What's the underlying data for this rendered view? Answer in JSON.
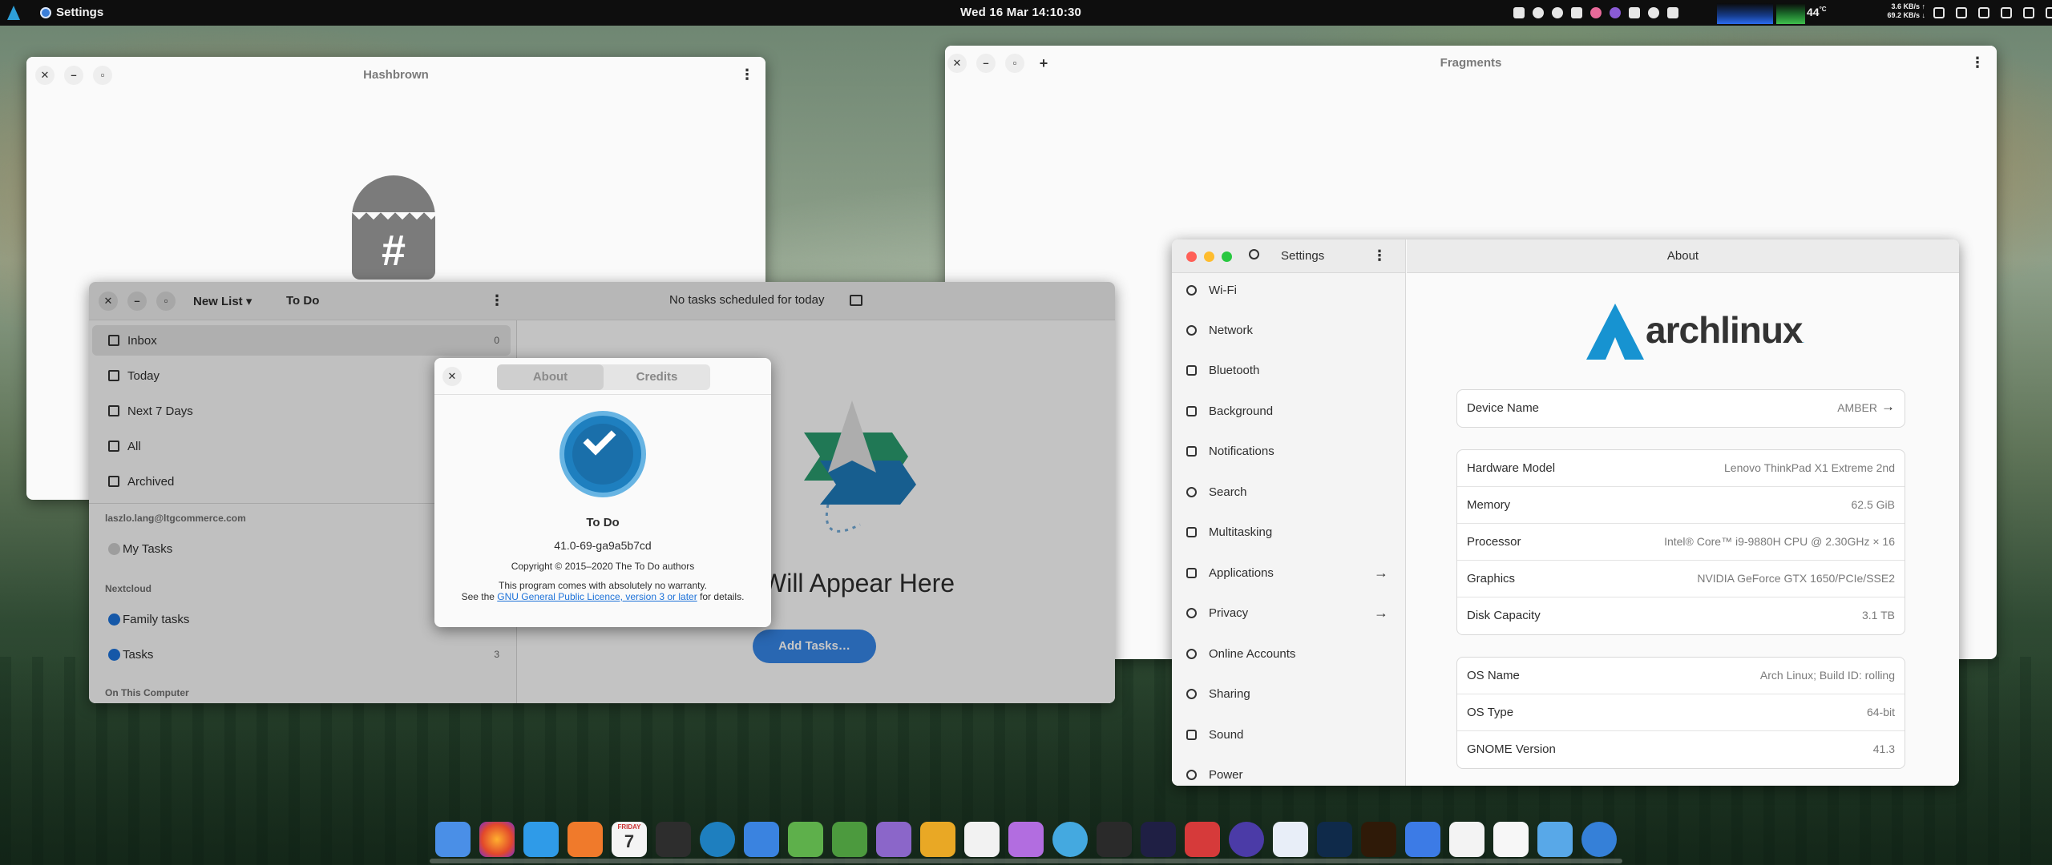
{
  "topbar": {
    "app_name": "Settings",
    "clock": "Wed 16 Mar  14:10:30",
    "temp": "44",
    "temp_unit": "°C",
    "net_up": "3.6 KB/s ↑",
    "net_down": "69.2 KB/s ↓"
  },
  "hashbrown": {
    "title": "Hashbrown",
    "logo_symbol": "#"
  },
  "fragments": {
    "title": "Fragments",
    "add": "+"
  },
  "todo": {
    "list_menu": "New List",
    "title": "To Do",
    "header": "No tasks scheduled for today",
    "items": [
      {
        "label": "Inbox",
        "count": "0"
      },
      {
        "label": "Today",
        "count": ""
      },
      {
        "label": "Next 7 Days",
        "count": ""
      },
      {
        "label": "All",
        "count": ""
      },
      {
        "label": "Archived",
        "count": ""
      }
    ],
    "account": "laszlo.lang@ltgcommerce.com",
    "my_tasks": "My Tasks",
    "nextcloud": "Nextcloud",
    "family": "Family tasks",
    "tasks": "Tasks",
    "tasks_count": "3",
    "on_computer": "On This Computer",
    "empty_text": "Will Appear Here",
    "add_tasks": "Add Tasks…"
  },
  "about": {
    "tab_about": "About",
    "tab_credits": "Credits",
    "name": "To Do",
    "version": "41.0-69-ga9a5b7cd",
    "copyright": "Copyright © 2015–2020 The To Do authors",
    "warranty": "This program comes with absolutely no warranty.",
    "see_the": "See the ",
    "licence": "GNU General Public Licence, version 3 or later",
    "for_details": " for details."
  },
  "settings": {
    "title": "Settings",
    "page_title": "About",
    "nav": [
      {
        "label": "Wi-Fi",
        "arrow": ""
      },
      {
        "label": "Network",
        "arrow": ""
      },
      {
        "label": "Bluetooth",
        "arrow": ""
      },
      {
        "label": "Background",
        "arrow": ""
      },
      {
        "label": "Notifications",
        "arrow": ""
      },
      {
        "label": "Search",
        "arrow": ""
      },
      {
        "label": "Multitasking",
        "arrow": ""
      },
      {
        "label": "Applications",
        "arrow": "→"
      },
      {
        "label": "Privacy",
        "arrow": "→"
      },
      {
        "label": "Online Accounts",
        "arrow": ""
      },
      {
        "label": "Sharing",
        "arrow": ""
      },
      {
        "label": "Sound",
        "arrow": ""
      },
      {
        "label": "Power",
        "arrow": ""
      }
    ],
    "logo_text": "archlinux",
    "device_name_key": "Device Name",
    "device_name_val": "AMBER",
    "hardware": [
      {
        "k": "Hardware Model",
        "v": "Lenovo ThinkPad X1 Extreme 2nd"
      },
      {
        "k": "Memory",
        "v": "62.5 GiB"
      },
      {
        "k": "Processor",
        "v": "Intel® Core™ i9-9880H CPU @ 2.30GHz × 16"
      },
      {
        "k": "Graphics",
        "v": "NVIDIA GeForce GTX 1650/PCIe/SSE2"
      },
      {
        "k": "Disk Capacity",
        "v": "3.1 TB"
      }
    ],
    "os": [
      {
        "k": "OS Name",
        "v": "Arch Linux; Build ID: rolling"
      },
      {
        "k": "OS Type",
        "v": "64-bit"
      },
      {
        "k": "GNOME Version",
        "v": "41.3"
      }
    ]
  },
  "calendar": {
    "day": "FRIDAY",
    "date": "7"
  },
  "colors": {
    "accent": "#3584e4",
    "arch_blue": "#1793d1",
    "todo_blue": "#1e7fbf"
  }
}
